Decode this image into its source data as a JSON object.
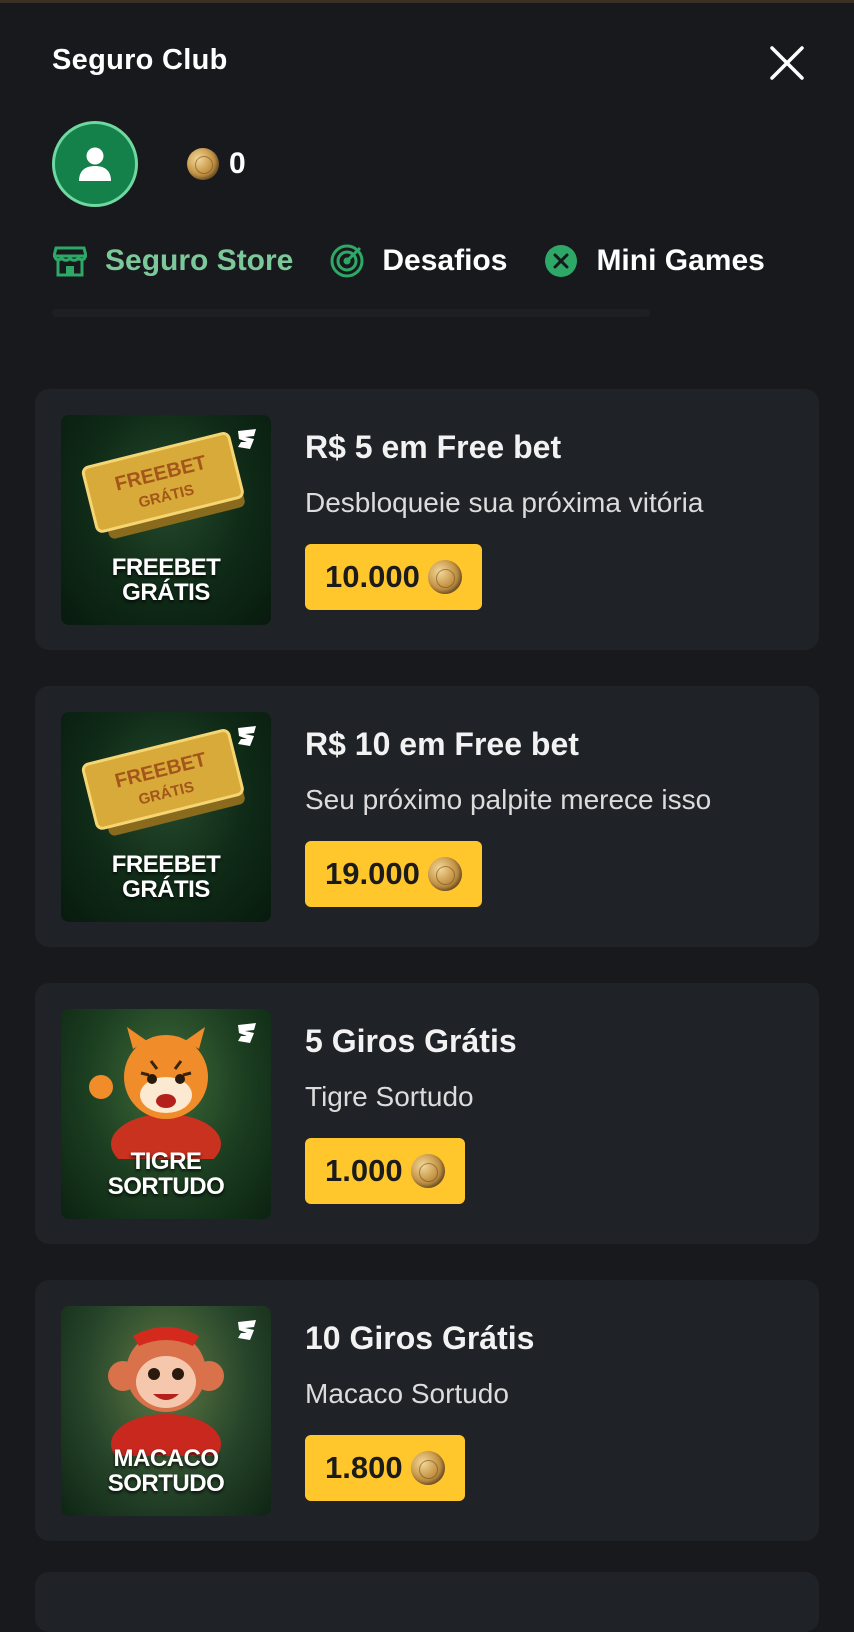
{
  "header": {
    "title": "Seguro Club",
    "close_icon": "close-icon"
  },
  "profile": {
    "avatar_icon": "user-icon",
    "coin_icon": "coin-icon",
    "balance": "0"
  },
  "tabs": [
    {
      "label": "Seguro Store",
      "icon": "store-icon",
      "active": true
    },
    {
      "label": "Desafios",
      "icon": "target-icon",
      "active": false
    },
    {
      "label": "Mini Games",
      "icon": "games-x-icon",
      "active": false
    }
  ],
  "rewards": [
    {
      "title": "R$ 5 em Free bet",
      "description": "Desbloqueie sua próxima vitória",
      "price": "10.000",
      "image_caption_line1": "FREEBET",
      "image_caption_line2": "GRÁTIS",
      "ticket_text": "FREEBET GRÁTIS"
    },
    {
      "title": "R$ 10 em Free bet",
      "description": "Seu próximo palpite merece isso",
      "price": "19.000",
      "image_caption_line1": "FREEBET",
      "image_caption_line2": "GRÁTIS",
      "ticket_text": "FREEBET GRÁTIS"
    },
    {
      "title": "5 Giros Grátis",
      "description": "Tigre Sortudo",
      "price": "1.000",
      "image_caption_line1": "TIGRE",
      "image_caption_line2": "SORTUDO"
    },
    {
      "title": "10 Giros Grátis",
      "description": "Macaco Sortudo",
      "price": "1.800",
      "image_caption_line1": "MACACO",
      "image_caption_line2": "SORTUDO"
    }
  ],
  "colors": {
    "background": "#17191c",
    "card": "#1f2226",
    "accent_green": "#7cc89a",
    "avatar_green": "#14804a",
    "price_yellow": "#ffc72c"
  }
}
